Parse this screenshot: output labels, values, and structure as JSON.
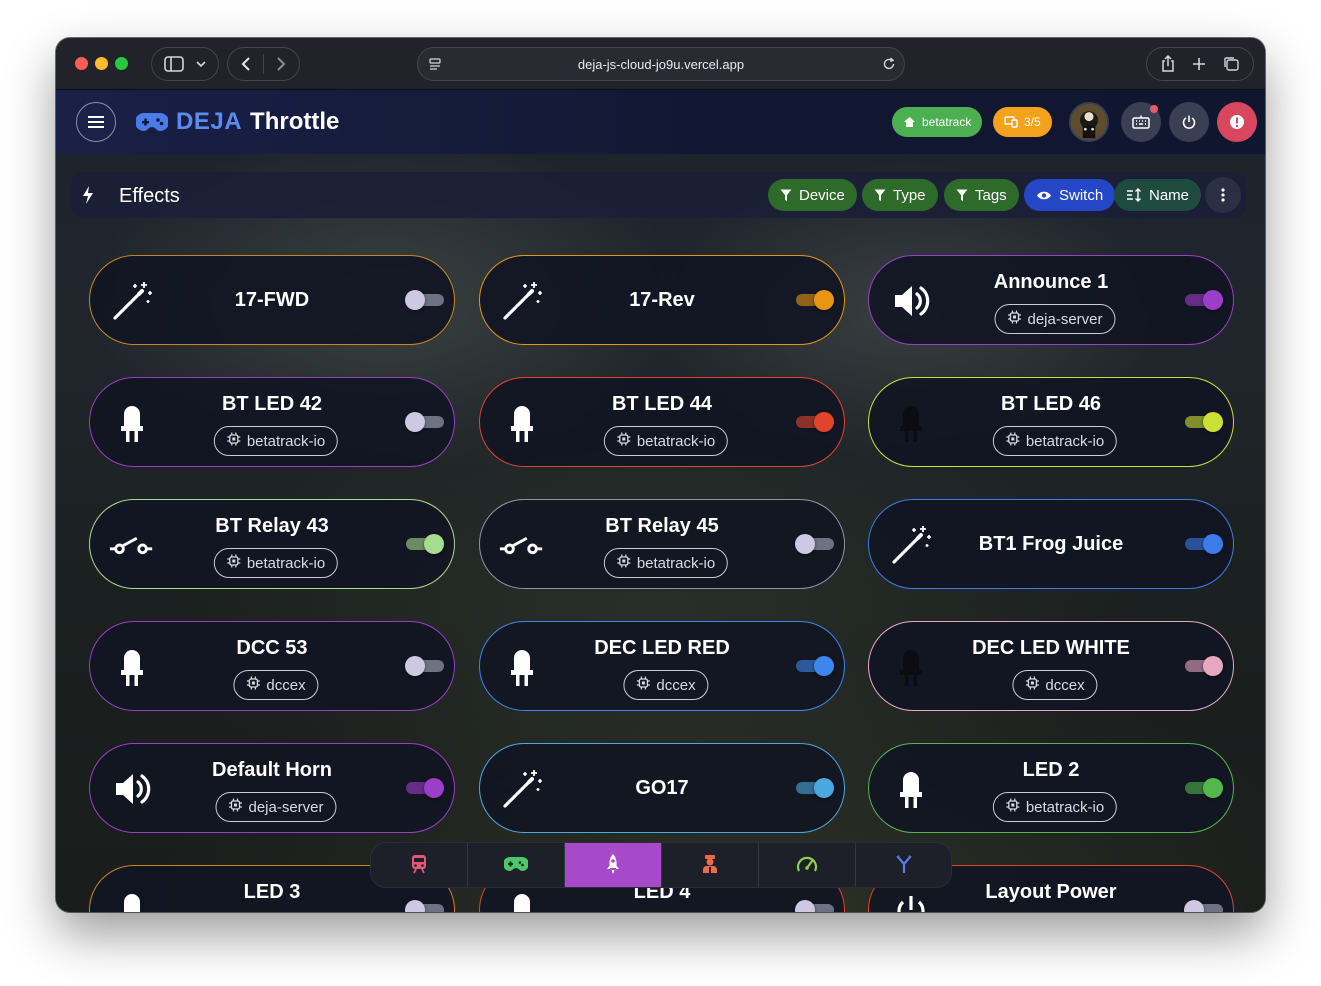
{
  "browser": {
    "url": "deja-js-cloud-jo9u.vercel.app"
  },
  "appbar": {
    "brand": "DEJA",
    "title": "Throttle",
    "layout_chip": "betatrack",
    "count_chip": "3/5"
  },
  "toolbar": {
    "title": "Effects",
    "filters": [
      {
        "label": "Device",
        "icon": "filter-icon"
      },
      {
        "label": "Type",
        "icon": "filter-icon"
      },
      {
        "label": "Tags",
        "icon": "filter-icon"
      },
      {
        "label": "Switch",
        "icon": "eye-icon"
      },
      {
        "label": "Name",
        "icon": "sort-icon"
      }
    ]
  },
  "effects": [
    {
      "name": "17-FWD",
      "device": "",
      "icon": "magic-wand-icon",
      "on": false,
      "color": "#c9861e"
    },
    {
      "name": "17-Rev",
      "device": "",
      "icon": "magic-wand-icon",
      "on": true,
      "color": "#e89414"
    },
    {
      "name": "Announce 1",
      "device": "deja-server",
      "icon": "speaker-icon",
      "on": true,
      "color": "#9c3ec8"
    },
    {
      "name": "BT LED 42",
      "device": "betatrack-io",
      "icon": "led-icon",
      "on": false,
      "color": "#9b3cc6"
    },
    {
      "name": "BT LED 44",
      "device": "betatrack-io",
      "icon": "led-icon",
      "on": true,
      "color": "#e0452c"
    },
    {
      "name": "BT LED 46",
      "device": "betatrack-io",
      "icon": "led-icon",
      "on": true,
      "color": "#cbe035"
    },
    {
      "name": "BT Relay 43",
      "device": "betatrack-io",
      "icon": "relay-icon",
      "on": true,
      "color": "#a5dc8e"
    },
    {
      "name": "BT Relay 45",
      "device": "betatrack-io",
      "icon": "relay-icon",
      "on": false,
      "color": "#8e94a8"
    },
    {
      "name": "BT1 Frog Juice",
      "device": "",
      "icon": "magic-wand-icon",
      "on": true,
      "color": "#3c7ce8"
    },
    {
      "name": "DCC 53",
      "device": "dccex",
      "icon": "led-icon",
      "on": false,
      "color": "#9b3cc6"
    },
    {
      "name": "DEC LED RED",
      "device": "dccex",
      "icon": "led-icon",
      "on": true,
      "color": "#3c86ec"
    },
    {
      "name": "DEC LED WHITE",
      "device": "dccex",
      "icon": "led-icon",
      "on": true,
      "color": "#e8a7c0"
    },
    {
      "name": "Default Horn",
      "device": "deja-server",
      "icon": "speaker-icon",
      "on": true,
      "color": "#9c3ec8"
    },
    {
      "name": "GO17",
      "device": "",
      "icon": "magic-wand-icon",
      "on": true,
      "color": "#4aa8e0"
    },
    {
      "name": "LED 2",
      "device": "betatrack-io",
      "icon": "led-icon",
      "on": true,
      "color": "#52b84c"
    },
    {
      "name": "LED 3",
      "device": "",
      "icon": "led-icon",
      "on": false,
      "color": "#c9861e"
    },
    {
      "name": "LED 4",
      "device": "",
      "icon": "led-icon",
      "on": false,
      "color": "#e0452c"
    },
    {
      "name": "Layout Power",
      "device": "",
      "icon": "power-icon",
      "on": false,
      "color": "#e0452c"
    }
  ],
  "bottom_nav": [
    {
      "name": "trains",
      "icon": "train-icon",
      "color": "#e8557a",
      "active": false
    },
    {
      "name": "throttle",
      "icon": "gamepad-icon",
      "color": "#4cc86a",
      "active": false
    },
    {
      "name": "effects",
      "icon": "rocket-icon",
      "color": "#ffffff",
      "active": true
    },
    {
      "name": "conductor",
      "icon": "conductor-icon",
      "color": "#f06a4a",
      "active": false
    },
    {
      "name": "speed",
      "icon": "speedometer-icon",
      "color": "#8ed04a",
      "active": false
    },
    {
      "name": "turnouts",
      "icon": "fork-icon",
      "color": "#5a7cf0",
      "active": false
    }
  ]
}
